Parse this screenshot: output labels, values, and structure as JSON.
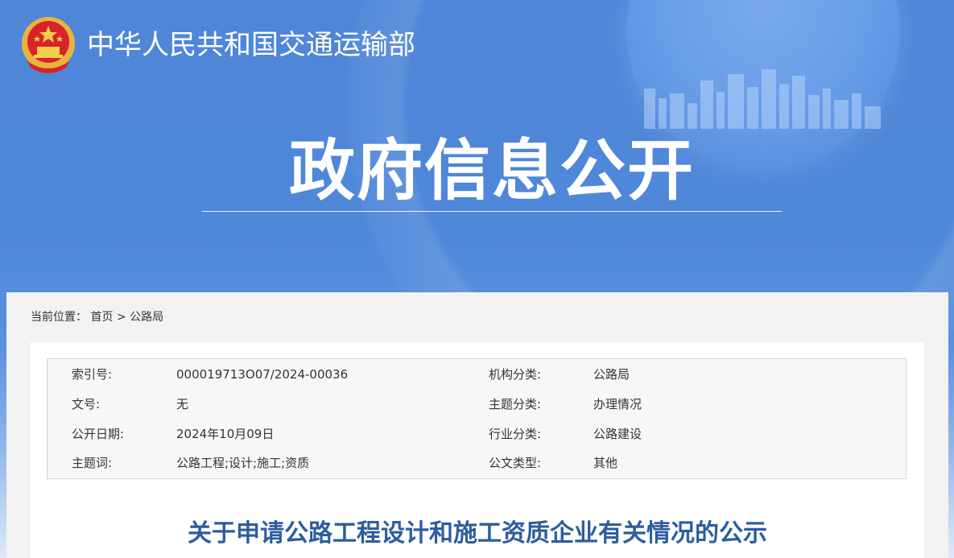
{
  "header": {
    "ministry_name": "中华人民共和国交通运输部",
    "section_title": "政府信息公开",
    "logo_icon": "national-emblem-icon"
  },
  "breadcrumb": {
    "label": "当前位置：",
    "home": "首页",
    "separator": ">",
    "current": "公路局"
  },
  "meta": {
    "rows": [
      {
        "k1": "索引号:",
        "v1": "000019713O07/2024-00036",
        "k2": "机构分类:",
        "v2": "公路局"
      },
      {
        "k1": "文号:",
        "v1": "无",
        "k2": "主题分类:",
        "v2": "办理情况"
      },
      {
        "k1": "公开日期:",
        "v1": "2024年10月09日",
        "k2": "行业分类:",
        "v2": "公路建设"
      },
      {
        "k1": "主题词:",
        "v1": "公路工程;设计;施工;资质",
        "k2": "公文类型:",
        "v2": "其他"
      }
    ]
  },
  "document": {
    "title": "关于申请公路工程设计和施工资质企业有关情况的公示"
  },
  "colors": {
    "banner_blue": "#4f86d8",
    "title_blue": "#2c5d9e"
  }
}
